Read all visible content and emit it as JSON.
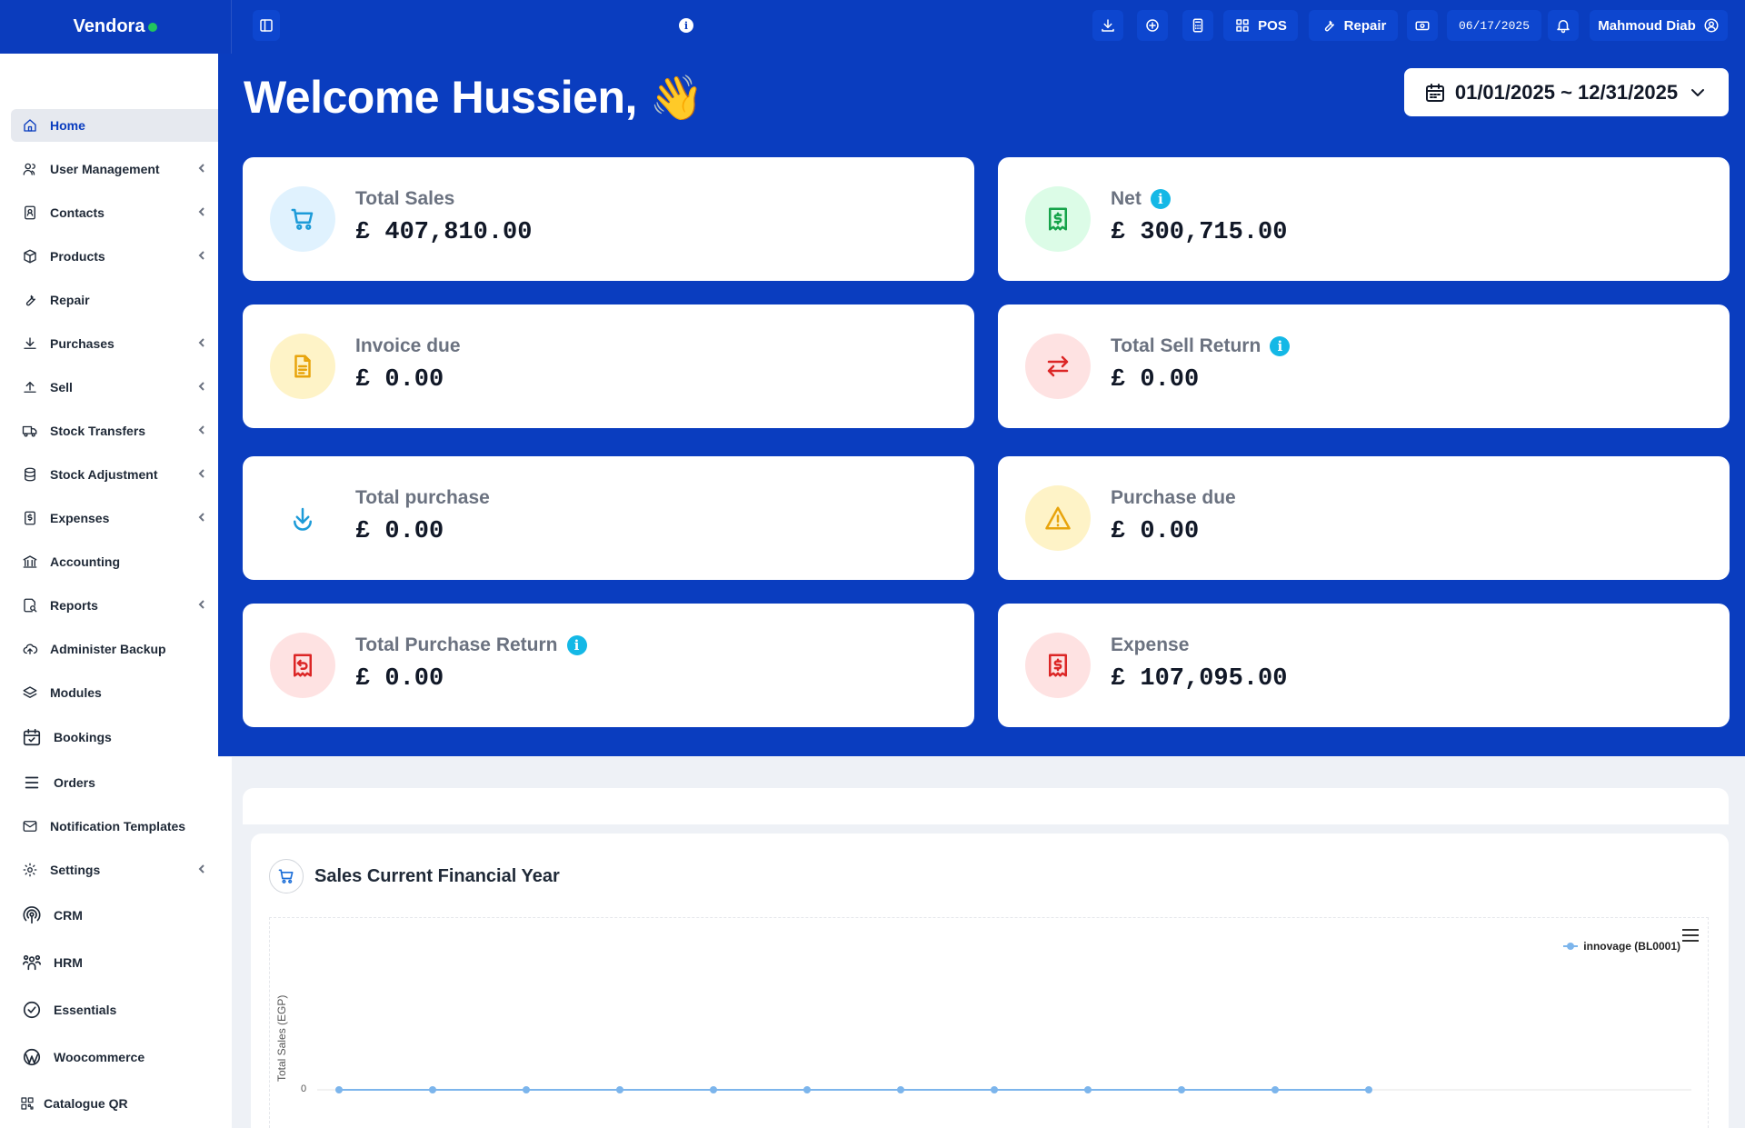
{
  "brand": {
    "name": "Vendora",
    "status_color": "#22c55e"
  },
  "topbar": {
    "pos_label": "POS",
    "repair_label": "Repair",
    "date": "06/17/2025",
    "user": "Mahmoud Diab",
    "icons": [
      "sidebar-toggle-icon",
      "info-icon",
      "download-icon",
      "plus-circle-icon",
      "calculator-icon",
      "grid-icon",
      "wrench-icon",
      "cash-icon",
      "bell-icon",
      "user-circle-icon"
    ]
  },
  "sidebar": {
    "items": [
      {
        "label": "Home",
        "icon": "home-icon",
        "active": true
      },
      {
        "label": "User Management",
        "icon": "users-icon",
        "chevron": true
      },
      {
        "label": "Contacts",
        "icon": "contacts-icon",
        "chevron": true
      },
      {
        "label": "Products",
        "icon": "box-icon",
        "chevron": true
      },
      {
        "label": "Repair",
        "icon": "wrench-icon"
      },
      {
        "label": "Purchases",
        "icon": "arrow-down-icon",
        "chevron": true
      },
      {
        "label": "Sell",
        "icon": "arrow-up-icon",
        "chevron": true
      },
      {
        "label": "Stock Transfers",
        "icon": "truck-icon",
        "chevron": true
      },
      {
        "label": "Stock Adjustment",
        "icon": "database-icon",
        "chevron": true
      },
      {
        "label": "Expenses",
        "icon": "dollar-doc-icon",
        "chevron": true
      },
      {
        "label": "Accounting",
        "icon": "bank-icon"
      },
      {
        "label": "Reports",
        "icon": "report-icon",
        "chevron": true
      },
      {
        "label": "Administer Backup",
        "icon": "cloud-upload-icon"
      },
      {
        "label": "Modules",
        "icon": "layers-icon"
      },
      {
        "label": "Bookings",
        "icon": "calendar-check-icon"
      },
      {
        "label": "Orders",
        "icon": "list-icon"
      },
      {
        "label": "Notification Templates",
        "icon": "mail-icon"
      },
      {
        "label": "Settings",
        "icon": "gear-icon",
        "chevron": true
      },
      {
        "label": "CRM",
        "icon": "broadcast-icon"
      },
      {
        "label": "HRM",
        "icon": "team-icon"
      },
      {
        "label": "Essentials",
        "icon": "check-circle-icon"
      },
      {
        "label": "Woocommerce",
        "icon": "wordpress-icon"
      },
      {
        "label": "Catalogue QR",
        "icon": "qr-icon"
      }
    ]
  },
  "hero": {
    "welcome": "Welcome Hussien,",
    "wave": "👋",
    "date_range": "01/01/2025 ~ 12/31/2025"
  },
  "cards": [
    {
      "label": "Total Sales",
      "value": "£ 407,810.00",
      "icon": "cart-icon",
      "color": "#1d9bd8",
      "bg": "#e0f2fe",
      "info": false
    },
    {
      "label": "Net",
      "value": "£ 300,715.00",
      "icon": "receipt-dollar-icon",
      "color": "#16a34a",
      "bg": "#dcfce7",
      "info": true
    },
    {
      "label": "Invoice due",
      "value": "£ 0.00",
      "icon": "document-icon",
      "color": "#eab308",
      "bg": "#fef3c7",
      "info": false
    },
    {
      "label": "Total Sell Return",
      "value": "£ 0.00",
      "icon": "swap-arrows-icon",
      "color": "#dc2626",
      "bg": "#fee2e2",
      "info": true
    },
    {
      "label": "Total purchase",
      "value": "£ 0.00",
      "icon": "download-arrow-icon",
      "color": "#1d9bd8",
      "bg": "#ffffff",
      "info": false
    },
    {
      "label": "Purchase due",
      "value": "£ 0.00",
      "icon": "warning-icon",
      "color": "#eab308",
      "bg": "#fef3c7",
      "info": false
    },
    {
      "label": "Total Purchase Return",
      "value": "£ 0.00",
      "icon": "receipt-return-icon",
      "color": "#dc2626",
      "bg": "#fee2e2",
      "info": true
    },
    {
      "label": "Expense",
      "value": "£ 107,095.00",
      "icon": "receipt-dollar-icon",
      "color": "#dc2626",
      "bg": "#fee2e2",
      "info": false
    }
  ],
  "sales_chart": {
    "title": "Sales Current Financial Year",
    "menu_icon": "hamburger-icon"
  },
  "chart_data": {
    "type": "line",
    "title": "Sales Current Financial Year",
    "ylabel": "Total Sales (EGP)",
    "xlabel": "",
    "y_ticks": [
      "0"
    ],
    "legend_position": "top-right",
    "series": [
      {
        "name": "innovage (BL0001)",
        "color": "#7cb5ec",
        "values": [
          0,
          0,
          0,
          0,
          0,
          0,
          0,
          0,
          0,
          0,
          0,
          0
        ]
      }
    ]
  }
}
